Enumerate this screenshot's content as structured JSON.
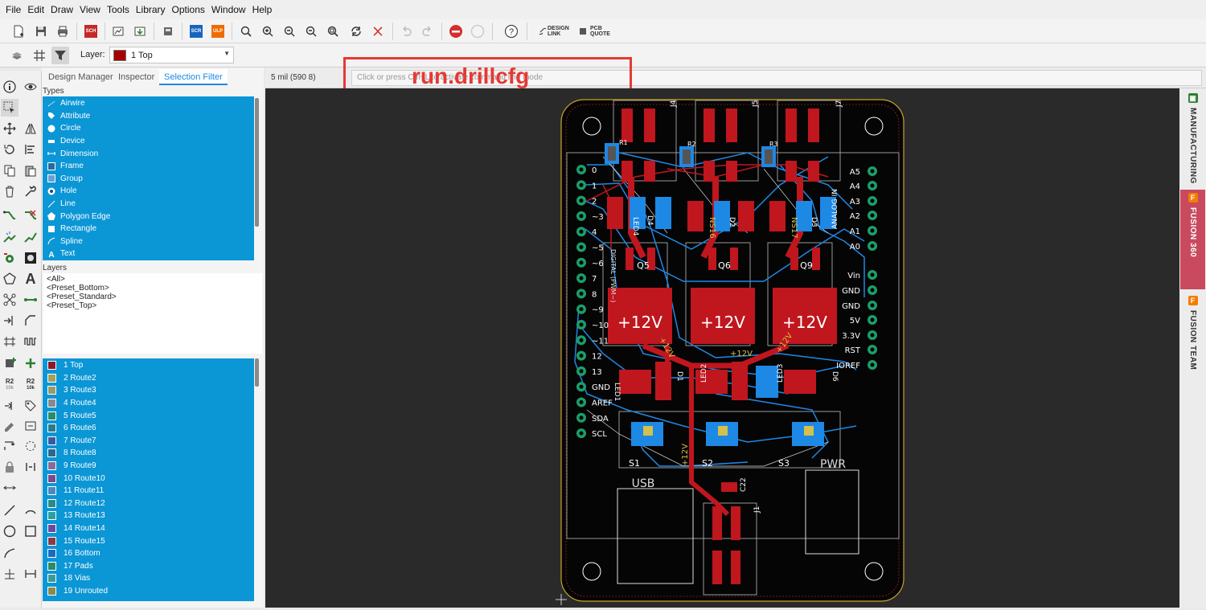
{
  "menu": [
    "File",
    "Edit",
    "Draw",
    "View",
    "Tools",
    "Library",
    "Options",
    "Window",
    "Help"
  ],
  "toolbar": {
    "design_link": "DESIGN\nLINK",
    "pcb_quote": "PCB\nQUOTE",
    "sch_label": "SCH",
    "scr_label": "SCR",
    "ulp_label": "ULP"
  },
  "layer_bar": {
    "label": "Layer:",
    "selected": "1 Top",
    "selected_color": "#a40000"
  },
  "panel": {
    "tabs": [
      "Design Manager",
      "Inspector",
      "Selection Filter"
    ],
    "active_tab": "Selection Filter",
    "types_label": "Types",
    "types": [
      {
        "label": "Airwire",
        "icon": "airwire-icon"
      },
      {
        "label": "Attribute",
        "icon": "tag-icon"
      },
      {
        "label": "Circle",
        "icon": "circle-icon"
      },
      {
        "label": "Device",
        "icon": "device-icon"
      },
      {
        "label": "Dimension",
        "icon": "dimension-icon"
      },
      {
        "label": "Frame",
        "icon": "frame-icon"
      },
      {
        "label": "Group",
        "icon": "group-icon"
      },
      {
        "label": "Hole",
        "icon": "hole-icon"
      },
      {
        "label": "Line",
        "icon": "line-icon"
      },
      {
        "label": "Polygon Edge",
        "icon": "polygon-icon"
      },
      {
        "label": "Rectangle",
        "icon": "rectangle-icon"
      },
      {
        "label": "Spline",
        "icon": "spline-icon"
      },
      {
        "label": "Text",
        "icon": "text-icon"
      }
    ],
    "layers_label": "Layers",
    "presets": [
      "<All>",
      "<Preset_Bottom>",
      "<Preset_Standard>",
      "<Preset_Top>"
    ],
    "layers": [
      {
        "label": "1 Top",
        "color": "#8a1a2a"
      },
      {
        "label": "2 Route2",
        "color": "#a0a060"
      },
      {
        "label": "3 Route3",
        "color": "#9a9a6a"
      },
      {
        "label": "4 Route4",
        "color": "#8a8a8a"
      },
      {
        "label": "5 Route5",
        "color": "#2a8a6a"
      },
      {
        "label": "6 Route6",
        "color": "#2a7a8a"
      },
      {
        "label": "7 Route7",
        "color": "#3a5aa0"
      },
      {
        "label": "8 Route8",
        "color": "#2a6a8a"
      },
      {
        "label": "9 Route9",
        "color": "#8a6a9a"
      },
      {
        "label": "10 Route10",
        "color": "#7a4a8a"
      },
      {
        "label": "11 Route11",
        "color": "#4a8ac0"
      },
      {
        "label": "12 Route12",
        "color": "#2a8a8a"
      },
      {
        "label": "13 Route13",
        "color": "#2aa0a0"
      },
      {
        "label": "14 Route14",
        "color": "#6a4aa0"
      },
      {
        "label": "15 Route15",
        "color": "#8a3a4a"
      },
      {
        "label": "16 Bottom",
        "color": "#1a6ac0"
      },
      {
        "label": "17 Pads",
        "color": "#2a8a6a"
      },
      {
        "label": "18 Vias",
        "color": "#3a9a9a"
      },
      {
        "label": "19 Unrouted",
        "color": "#8a8a4a"
      }
    ]
  },
  "command": {
    "grid_status": "5 mil (590 8)",
    "placeholder": "Click or press Ctrl+L to activate command line mode",
    "overlay_text": "run.drillcfg"
  },
  "right_tabs": [
    {
      "label": "MANUFACTURING",
      "color": "#2e7d32"
    },
    {
      "label": "FUSION 360",
      "color": "#f57c00"
    },
    {
      "label": "FUSION TEAM",
      "color": "#f57c00"
    }
  ],
  "board": {
    "connectors": [
      "J4",
      "J5",
      "J7",
      "J1"
    ],
    "transistors": [
      "Q5",
      "Q6",
      "Q9"
    ],
    "power_label": "+12V",
    "left_pins": [
      "0",
      "1",
      "2",
      "~3",
      "4",
      "~5",
      "~6",
      "7",
      "8",
      "~9",
      "~10",
      "~11",
      "12",
      "13",
      "GND",
      "AREF",
      "SDA",
      "SCL"
    ],
    "right_pins": [
      "A5",
      "A4",
      "A3",
      "A2",
      "A1",
      "A0",
      "Vin",
      "GND",
      "GND",
      "5V",
      "3.3V",
      "RST",
      "IOREF"
    ],
    "analog_in": "ANALOG IN",
    "digital_pwm": "DIGITAL (PWM~)",
    "usb": "USB",
    "pwr": "PWR",
    "switches": [
      "S1",
      "S2",
      "S3"
    ],
    "trace_labels": [
      "+12V",
      "+12V",
      "+12V",
      "+12V"
    ],
    "ns_labels": [
      "NS16",
      "NS17"
    ],
    "small_labels": [
      "R1",
      "R2",
      "R3",
      "D1",
      "D2",
      "D3",
      "D4",
      "D5",
      "D6",
      "LED1",
      "LED2",
      "LED3",
      "LED4",
      "LED5",
      "LED6",
      "C22"
    ]
  }
}
